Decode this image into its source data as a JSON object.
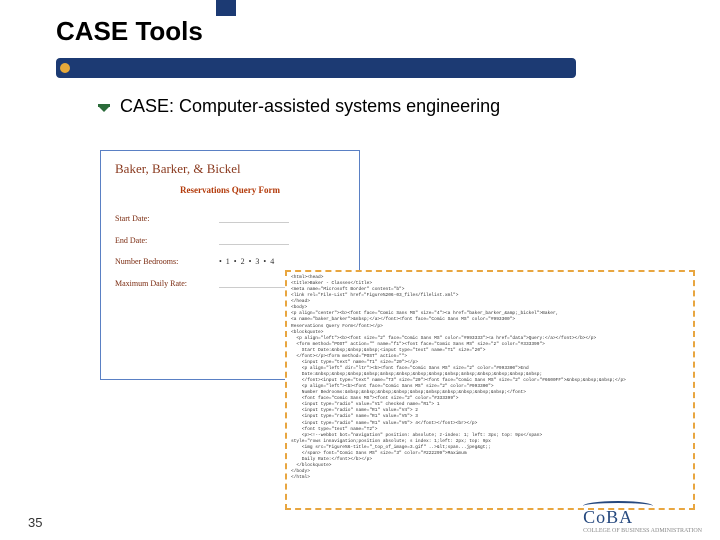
{
  "slide": {
    "title": "CASE Tools",
    "subtitle": "CASE: Computer-assisted systems engineering",
    "page_number": "35"
  },
  "rendered_form": {
    "heading": "Baker, Barker, & Bickel",
    "subheading": "Reservations Query Form",
    "fields": {
      "start_date": "Start Date:",
      "end_date": "End Date:",
      "bedrooms_label": "Number Bedrooms:",
      "bedrooms_options": "• 1 • 2 • 3 • 4",
      "max_rate": "Maximum Daily Rate:"
    }
  },
  "code": {
    "lines": [
      "<html><head>",
      "<title>Baker - Classes</title>",
      "<meta name=\"Microsoft Border\" content=\"b\">",
      "<link rel=\"File-List\" href=\"Figure%206-03_files/filelist.xml\">",
      "</head>",
      "<body>",
      "<p align=\"center\"><b><font face=\"Comic Sans MS\" size=\"4\"><a href=\"baker_barker_&amp;_bickel\">Baker,",
      "<a name=\"baker_barker\">&nbsp;</a></font><font face=\"Comic Sans MS\" color=\"#993300\">",
      "Reservations Query Form</font></p>",
      "<blockquote>",
      "  <p align=\"left\"><b><font size=\"2\" face=\"Comic Sans MS\" color=\"#993333\"><a href=\"data\">Query:</a></font></b></p>",
      "  <form method=\"POST\" action=\"\" name=\"f1\"><font face=\"Comic Sans MS\" size=\"2\" color=\"#333399\">",
      "    Start Date:&nbsp;&nbsp;&nbsp;<input type=\"text\" name=\"T1\" size=\"20\">",
      "  </font></p><form method=\"POST\" action=\"\">",
      "    <input type=\"text\" name=\"T1\" size=\"20\"></p>",
      "    <p align=\"left\" dir=\"ltr\"><b><font face=\"Comic Sans MS\" size=\"2\" color=\"#993300\">End",
      "    Date:&nbsp;&nbsp;&nbsp;&nbsp;&nbsp;&nbsp;&nbsp;&nbsp;&nbsp;&nbsp;&nbsp;&nbsp;&nbsp;&nbsp;",
      "    </font><input type=\"text\" name=\"T3\" size=\"20\"><font face=\"Comic Sans MS\" size=\"2\" color=\"#6600FF\">&nbsp;&nbsp;&nbsp;</p>",
      "    <p align=\"left\"><b><font face=\"Comic Sans MS\" size=\"2\" color=\"#993300\">",
      "    Number Bedrooms:&nbsp;&nbsp;&nbsp;&nbsp;&nbsp;&nbsp;&nbsp;&nbsp;&nbsp;&nbsp;</font>",
      "    <font face=\"Comic Sans MS\"><font size=\"2\" color=\"#333399\">",
      "    <input type=\"radio\" value=\"V1\" checked name=\"R1\"> 1",
      "    <input type=\"radio\" name=\"R1\" value=\"V4\"> 2",
      "    <input type=\"radio\" name=\"R1\" value=\"V5\"> 3",
      "    <input type=\"radio\" name=\"R1\" value=\"V6\"> 4</font></font><br></p>",
      "    <font type=\"text\" name=\"T2\">",
      "    <p><!--webbot bot=\"navigation\" position: absolute; z-index: 1; left: 3px; top: 9px</span>",
      "style=\"rows innavigation;position absolute; s index: 1;left: 2px; top: 9px",
      "    <img src=\"Figure%6-title=\"_top_of_image=3.gif\" ..>&lt;span...jpeg&gt;;",
      "    </span> font=\"Comic Sans MS\" size=\"3\" color=\"#222299\">Maximum",
      "    Daily Rate:</font></b></p>",
      "  </blockquote>",
      "</body>",
      "</html>"
    ]
  },
  "logo": {
    "text": "CoBA",
    "subtext": "COLLEGE OF BUSINESS ADMINISTRATION"
  }
}
